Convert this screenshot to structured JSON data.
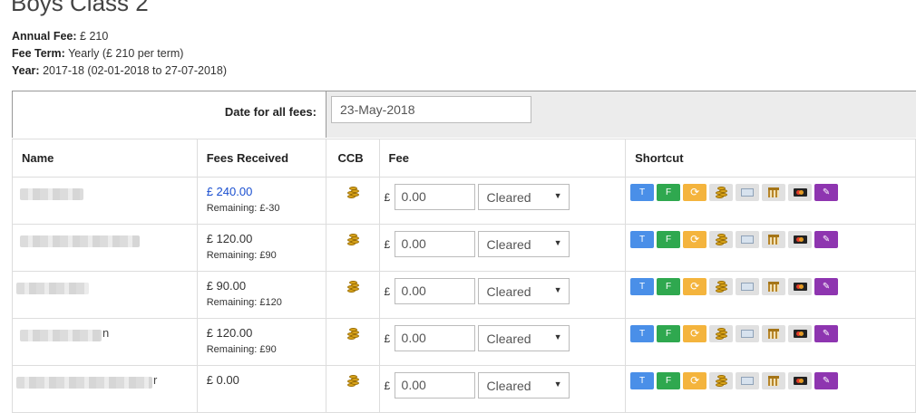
{
  "page": {
    "title": "Boys Class 2",
    "annual_fee_label": "Annual Fee:",
    "annual_fee_value": "£ 210",
    "fee_term_label": "Fee Term:",
    "fee_term_value": "Yearly (£ 210 per term)",
    "year_label": "Year:",
    "year_value": "2017-18 (02-01-2018 to 27-07-2018)"
  },
  "date_bar": {
    "label": "Date for all fees:",
    "value": "23-May-2018"
  },
  "table": {
    "headers": {
      "name": "Name",
      "fees_received": "Fees Received",
      "ccb": "CCB",
      "fee": "Fee",
      "shortcut": "Shortcut"
    },
    "currency_symbol": "£",
    "rows": [
      {
        "name_suffix": "",
        "received": "£ 240.00",
        "remaining": "Remaining: £-30",
        "fee": "0.00",
        "status": "Cleared"
      },
      {
        "name_suffix": "",
        "received": "£ 120.00",
        "remaining": "Remaining: £90",
        "fee": "0.00",
        "status": "Cleared"
      },
      {
        "name_suffix": "",
        "received": "£ 90.00",
        "remaining": "Remaining: £120",
        "fee": "0.00",
        "status": "Cleared"
      },
      {
        "name_suffix": "n",
        "received": "£ 120.00",
        "remaining": "Remaining: £90",
        "fee": "0.00",
        "status": "Cleared"
      },
      {
        "name_suffix": "r",
        "received": "£ 0.00",
        "remaining": "",
        "fee": "0.00",
        "status": "Cleared"
      }
    ]
  },
  "shortcuts": {
    "t_label": "T",
    "f_label": "F",
    "refresh_glyph": "⟳",
    "edit_glyph": "✎"
  },
  "colors": {
    "link_amount": "#1a4fd0",
    "btn_t": "#4a8fe8",
    "btn_f": "#2fa84f",
    "btn_refresh": "#f4b43d",
    "btn_edit": "#8e35b0"
  }
}
